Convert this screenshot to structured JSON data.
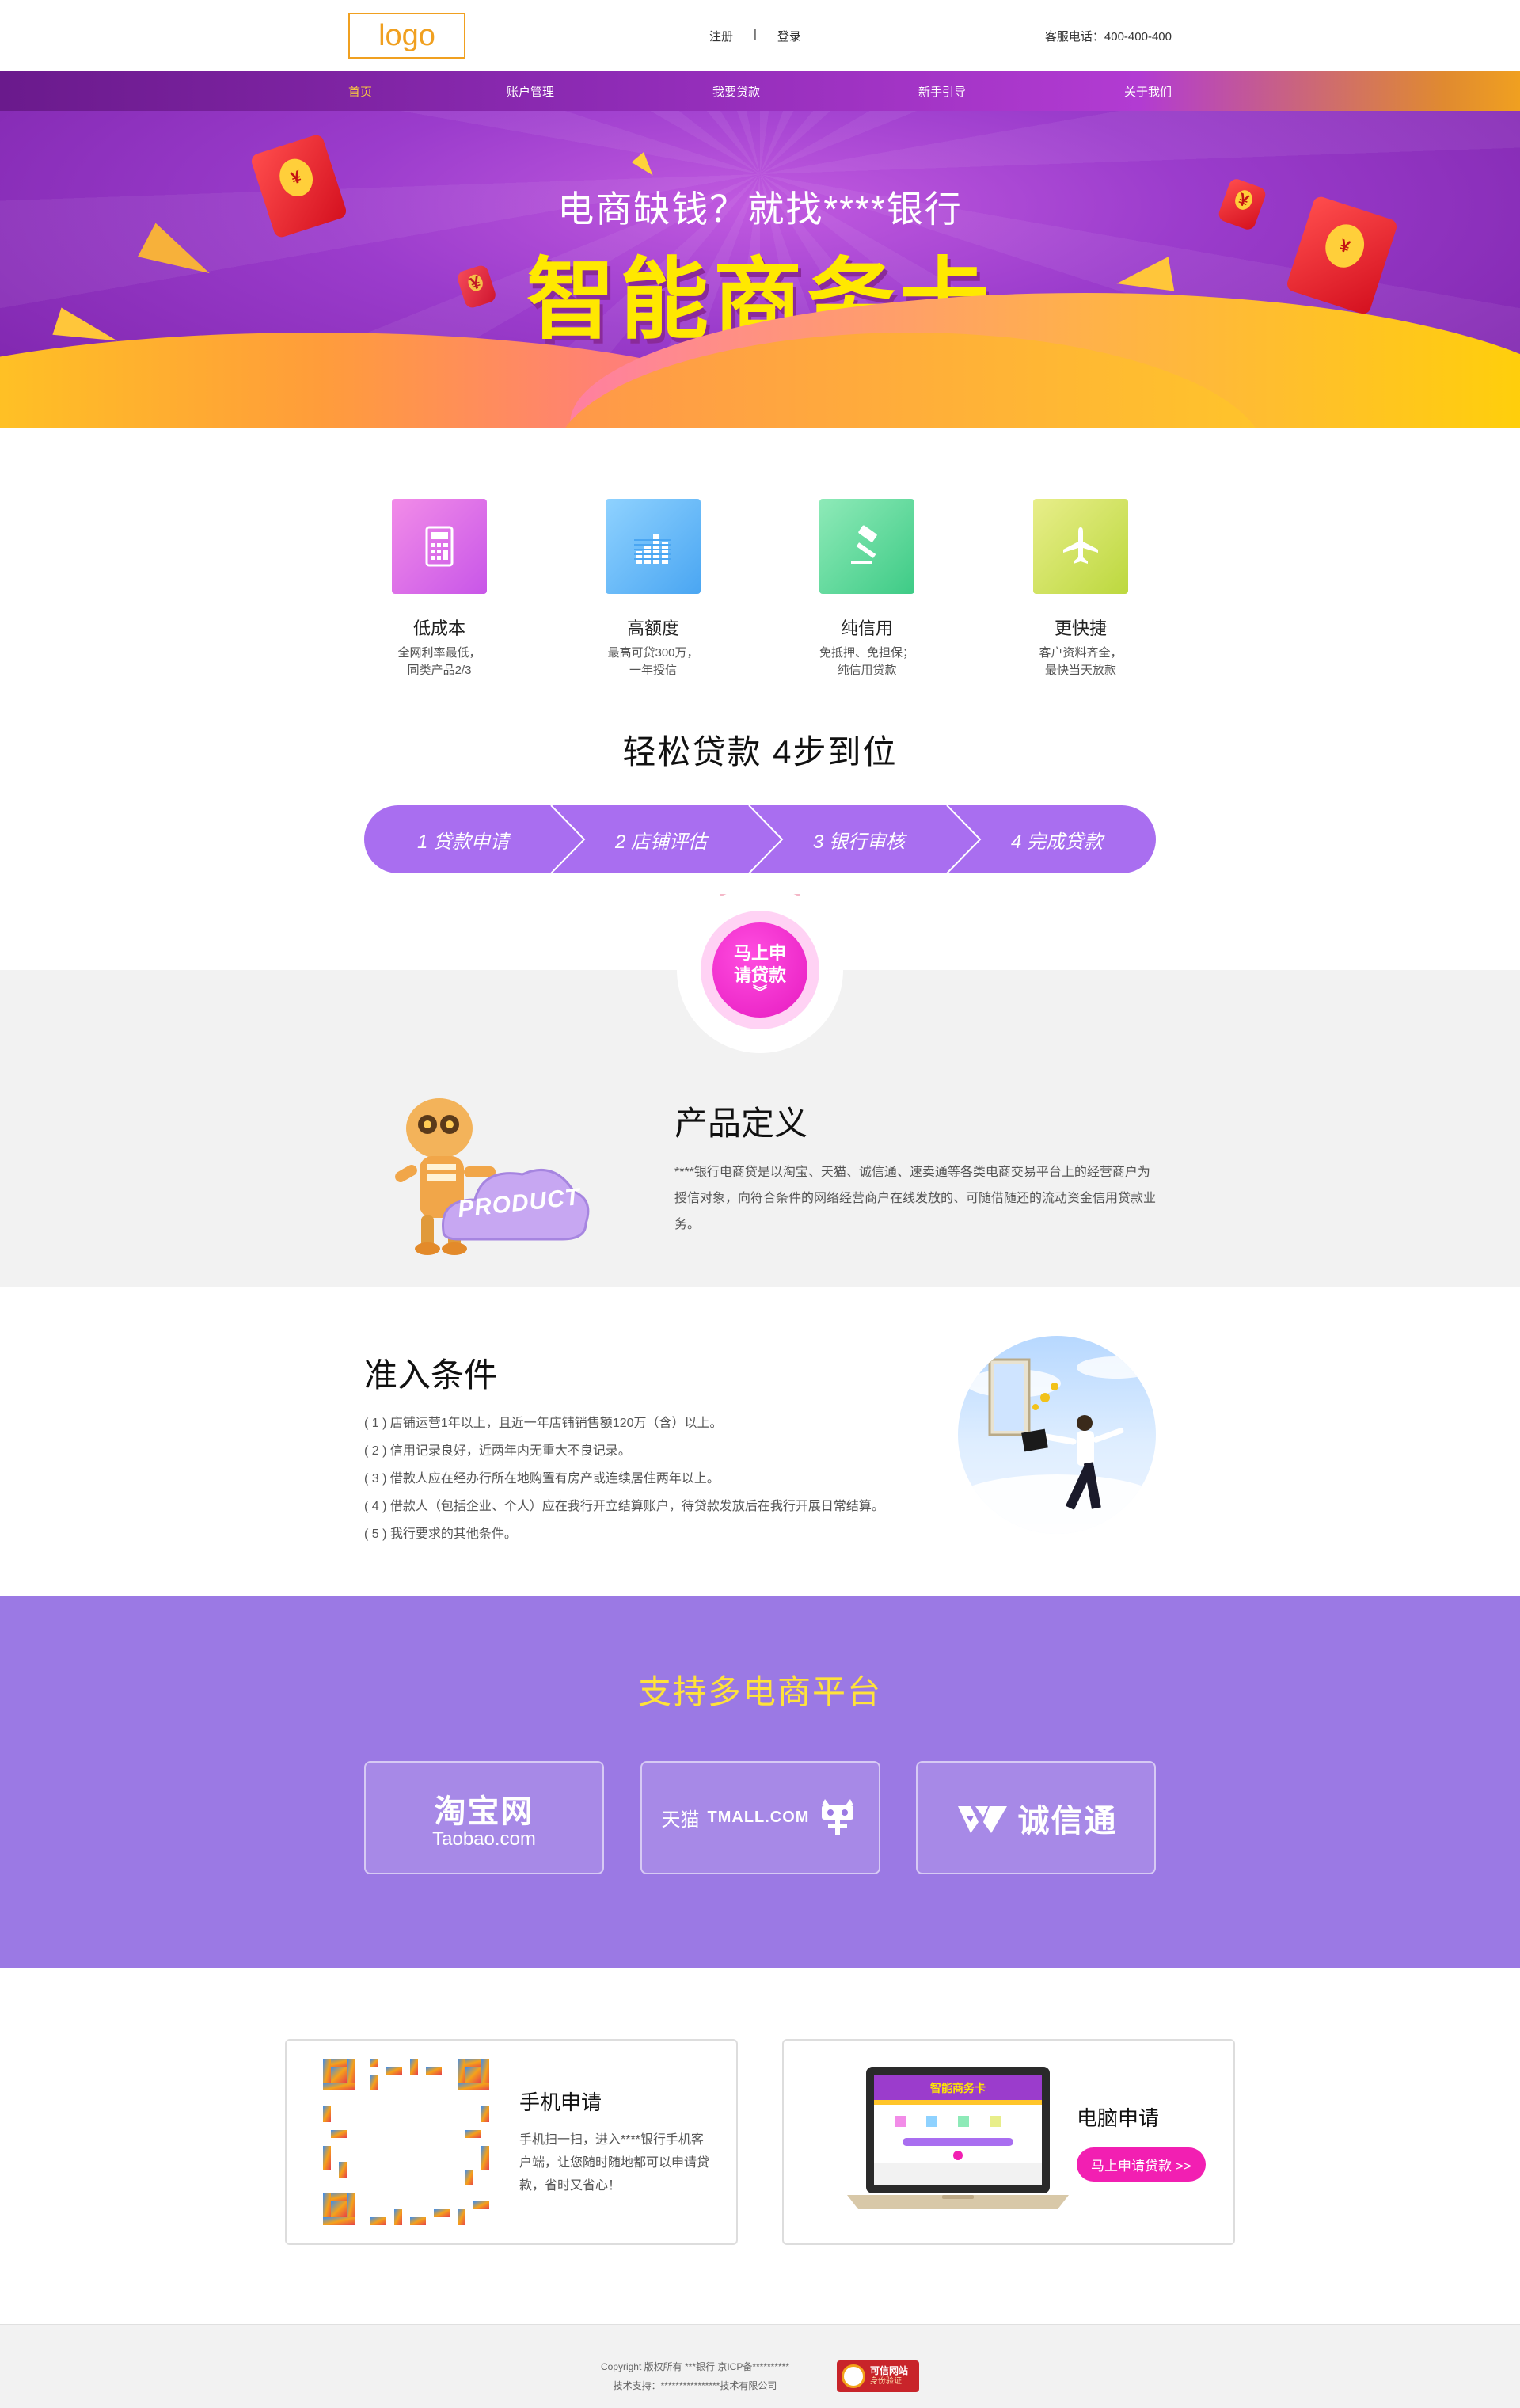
{
  "header": {
    "logo": "logo",
    "register": "注册",
    "separator": "|",
    "login": "登录",
    "hotline": "客服电话：400-400-400"
  },
  "nav": {
    "items": [
      "首页",
      "账户管理",
      "我要贷款",
      "新手引导",
      "关于我们"
    ],
    "active_color": "#f5c542"
  },
  "banner": {
    "subtitle": "电商缺钱？就找****银行",
    "title": "智能商务卡"
  },
  "features": [
    {
      "icon": "calculator-icon",
      "title": "低成本",
      "desc": "全网利率最低，\n同类产品2/3"
    },
    {
      "icon": "bar-chart-icon",
      "title": "高额度",
      "desc": "最高可贷300万，\n一年授信"
    },
    {
      "icon": "gavel-icon",
      "title": "纯信用",
      "desc": "免抵押、免担保；\n纯信用贷款"
    },
    {
      "icon": "airplane-icon",
      "title": "更快捷",
      "desc": "客户资料齐全，\n最快当天放款"
    }
  ],
  "steps": {
    "title": "轻松贷款   4步到位",
    "items": [
      "1  贷款申请",
      "2  店铺评估",
      "3  银行审核",
      "4  完成贷款"
    ],
    "color": "#a96ef0"
  },
  "apply": {
    "line1": "马上申",
    "line2": "请贷款",
    "chevron": "︾"
  },
  "product": {
    "badge": "PRODUCT",
    "title": "产品定义",
    "body": "****银行电商贷是以淘宝、天猫、诚信通、速卖通等各类电商交易平台上的经营商户为授信对象，向符合条件的网络经营商户在线发放的、可随借随还的流动资金信用贷款业务。"
  },
  "conditions": {
    "title": "准入条件",
    "items": [
      "( 1 ) 店铺运营1年以上，且近一年店铺销售额120万（含）以上。",
      "( 2 ) 信用记录良好，近两年内无重大不良记录。",
      "( 3 ) 借款人应在经办行所在地购置有房产或连续居住两年以上。",
      "( 4 ) 借款人（包括企业、个人）应在我行开立结算账户，待贷款发放后在我行开展日常结算。",
      "( 5 ) 我行要求的其他条件。"
    ]
  },
  "platforms": {
    "title": "支持多电商平台",
    "taobao": {
      "name": "淘宝网",
      "sub": "Taobao.com"
    },
    "tmall": {
      "cn": "天猫",
      "en": "TMALL.COM"
    },
    "chengxin": {
      "name": "诚信通"
    },
    "bg_color": "#9b79e4",
    "title_color": "#ffe23a"
  },
  "channels": {
    "mobile": {
      "title": "手机申请",
      "body": "手机扫一扫，进入****银行手机客户端，让您随时随地都可以申请贷款，省时又省心！"
    },
    "pc": {
      "title": "电脑申请",
      "button": "马上申请贷款  >>",
      "screen_title": "智能商务卡"
    }
  },
  "footer": {
    "line1": "Copyright 版权所有 ***银行 京ICP备**********",
    "line2": "技术支持：****************技术有限公司",
    "trust_title": "可信网站",
    "trust_sub": "身份验证"
  }
}
